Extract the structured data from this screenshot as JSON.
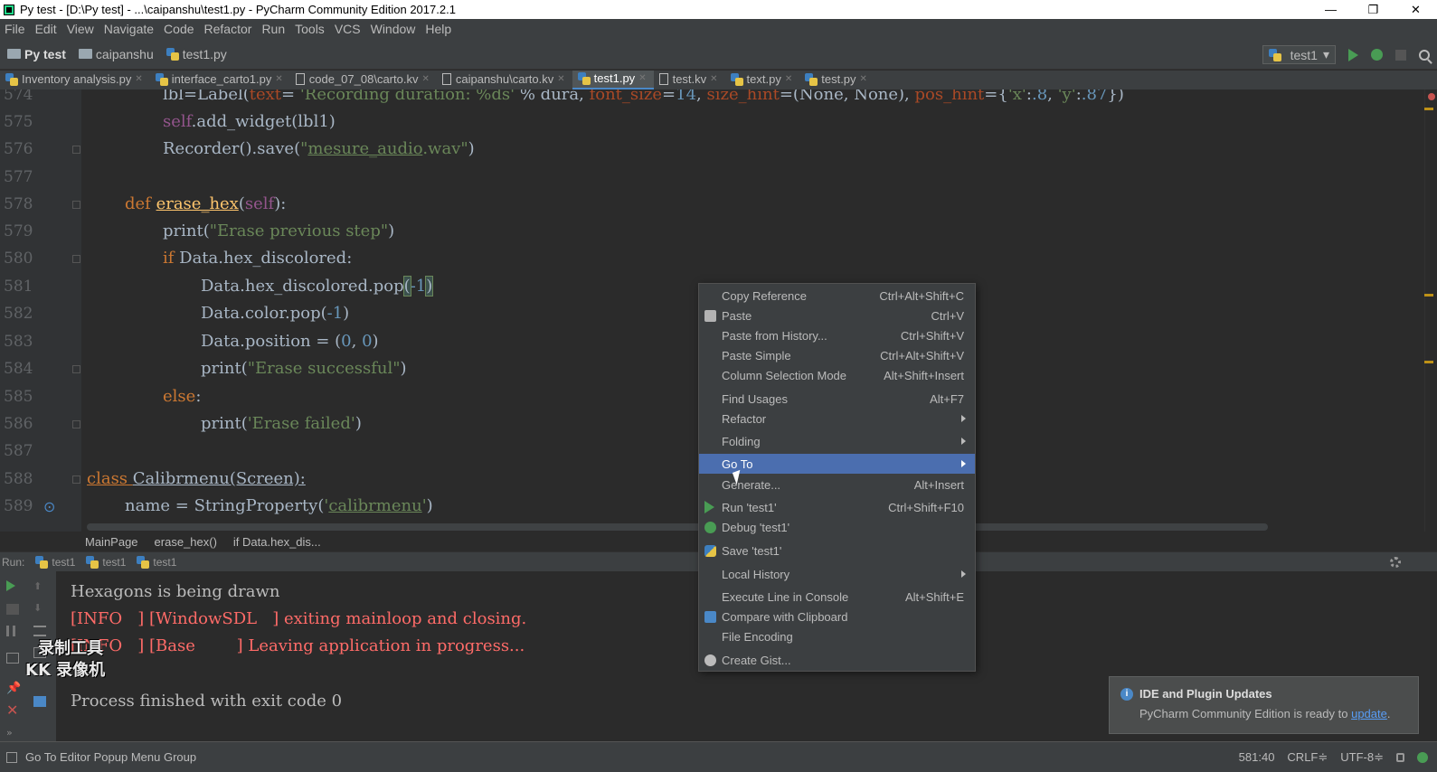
{
  "window": {
    "title": "Py test - [D:\\Py test] - ...\\caipanshu\\test1.py - PyCharm Community Edition 2017.2.1",
    "minimize": "—",
    "maximize": "❐",
    "close": "✕"
  },
  "menubar": [
    "File",
    "Edit",
    "View",
    "Navigate",
    "Code",
    "Refactor",
    "Run",
    "Tools",
    "VCS",
    "Window",
    "Help"
  ],
  "navbar": {
    "project": "Py test",
    "folder": "caipanshu",
    "file": "test1.py",
    "run_config": "test1"
  },
  "tabs": [
    {
      "label": "Inventory analysis.py",
      "type": "py"
    },
    {
      "label": "interface_carto1.py",
      "type": "py"
    },
    {
      "label": "code_07_08\\carto.kv",
      "type": "kv"
    },
    {
      "label": "caipanshu\\carto.kv",
      "type": "kv"
    },
    {
      "label": "test1.py",
      "type": "py",
      "active": true
    },
    {
      "label": "test.kv",
      "type": "kv"
    },
    {
      "label": "text.py",
      "type": "py"
    },
    {
      "label": "test.py",
      "type": "py"
    }
  ],
  "editor": {
    "line_numbers": [
      "574",
      "575",
      "576",
      "577",
      "578",
      "579",
      "580",
      "581",
      "582",
      "583",
      "584",
      "585",
      "586",
      "587",
      "588",
      "589"
    ],
    "code": {
      "l574a": "lbl=Label(",
      "l574b": "text",
      "l574c": "= ",
      "l574d": "'Recording duration: %ds'",
      "l574e": " % dura, ",
      "l574f": "font_size",
      "l574g": "=",
      "l574h": "14",
      "l574i": ", ",
      "l574j": "size_hint",
      "l574k": "=(None, None), ",
      "l574l": "pos_hint",
      "l574m": "={",
      "l574n": "'x'",
      "l574o": ":",
      "l574p": ".8",
      "l574q": ", ",
      "l574r": "'y'",
      "l574s": ":",
      "l574t": ".87",
      "l574u": "})",
      "l575a": "self",
      "l575b": ".add_widget(lbl1)",
      "l576a": "Recorder().save(",
      "l576b": "\"",
      "l576c": "mesure_audio",
      "l576d": ".wav\"",
      "l576e": ")",
      "l578a": "def ",
      "l578b": "erase_hex",
      "l578c": "(",
      "l578d": "self",
      "l578e": "):",
      "l579a": "print(",
      "l579b": "\"Erase previous step\"",
      "l579c": ")",
      "l580a": "if ",
      "l580b": "Data.hex_discolored:",
      "l581a": "Data.hex_discolored.pop",
      "l581b": "(",
      "l581c": "-1",
      "l581d": ")",
      "l582a": "Data.color.pop(",
      "l582b": "-1",
      "l582c": ")",
      "l583a": "Data.position = (",
      "l583b": "0",
      "l583c": ", ",
      "l583d": "0",
      "l583e": ")",
      "l584a": "print(",
      "l584b": "\"Erase successful\"",
      "l584c": ")",
      "l585a": "else",
      "l585b": ":",
      "l586a": "print(",
      "l586b": "'Erase failed'",
      "l586c": ")",
      "l588a": "class ",
      "l588b": "Calibrmenu(Screen):",
      "l589a": "name = StringProperty(",
      "l589b": "'",
      "l589c": "calibrmenu",
      "l589d": "'",
      "l589e": ")"
    },
    "breadcrumbs": [
      "MainPage",
      "erase_hex()",
      "if Data.hex_dis..."
    ]
  },
  "run_panel": {
    "label": "Run:",
    "tabs": [
      "test1",
      "test1",
      "test1"
    ],
    "output": [
      {
        "text": "Hexagons is being drawn",
        "type": "normal"
      },
      {
        "text": "[INFO   ] [WindowSDL   ] exiting mainloop and closing.",
        "type": "error"
      },
      {
        "text": "[INFO   ] [Base        ] Leaving application in progress...",
        "type": "error"
      },
      {
        "text": "",
        "type": "normal"
      },
      {
        "text": "Process finished with exit code 0",
        "type": "normal"
      }
    ],
    "watermark_line1": "录制工具",
    "watermark_line2": "KK 录像机"
  },
  "context_menu": {
    "items": [
      {
        "label": "Copy Reference",
        "shortcut": "Ctrl+Alt+Shift+C",
        "icon": ""
      },
      {
        "label": "Paste",
        "shortcut": "Ctrl+V",
        "icon": "clipboard-icon"
      },
      {
        "label": "Paste from History...",
        "shortcut": "Ctrl+Shift+V",
        "icon": ""
      },
      {
        "label": "Paste Simple",
        "shortcut": "Ctrl+Alt+Shift+V",
        "icon": ""
      },
      {
        "label": "Column Selection Mode",
        "shortcut": "Alt+Shift+Insert",
        "icon": ""
      },
      {
        "label": "Find Usages",
        "shortcut": "Alt+F7",
        "icon": ""
      },
      {
        "label": "Refactor",
        "shortcut": "",
        "submenu": true,
        "icon": ""
      },
      {
        "label": "Folding",
        "shortcut": "",
        "submenu": true,
        "icon": ""
      },
      {
        "label": "Go To",
        "shortcut": "",
        "submenu": true,
        "selected": true,
        "icon": ""
      },
      {
        "label": "Generate...",
        "shortcut": "Alt+Insert",
        "icon": ""
      },
      {
        "label": "Run 'test1'",
        "shortcut": "Ctrl+Shift+F10",
        "icon": "run-icon"
      },
      {
        "label": "Debug 'test1'",
        "shortcut": "",
        "icon": "debug-icon"
      },
      {
        "label": "Save 'test1'",
        "shortcut": "",
        "icon": "python-icon"
      },
      {
        "label": "Local History",
        "shortcut": "",
        "submenu": true,
        "icon": ""
      },
      {
        "label": "Execute Line in Console",
        "shortcut": "Alt+Shift+E",
        "icon": ""
      },
      {
        "label": "Compare with Clipboard",
        "shortcut": "",
        "icon": "compare-icon"
      },
      {
        "label": "File Encoding",
        "shortcut": "",
        "icon": ""
      },
      {
        "label": "Create Gist...",
        "shortcut": "",
        "icon": "github-icon"
      }
    ]
  },
  "notification": {
    "title": "IDE and Plugin Updates",
    "body": "PyCharm Community Edition is ready to ",
    "link": "update",
    "suffix": "."
  },
  "statusbar": {
    "message": "Go To Editor Popup Menu Group",
    "position": "581:40",
    "line_sep": "CRLF≑",
    "encoding": "UTF-8≑"
  },
  "colors": {
    "accent": "#4b6eaf",
    "editor_bg": "#2b2b2b",
    "panel_bg": "#3c3f41",
    "keyword": "#cc7832",
    "string": "#6a8759",
    "error_text": "#ff6b68"
  }
}
